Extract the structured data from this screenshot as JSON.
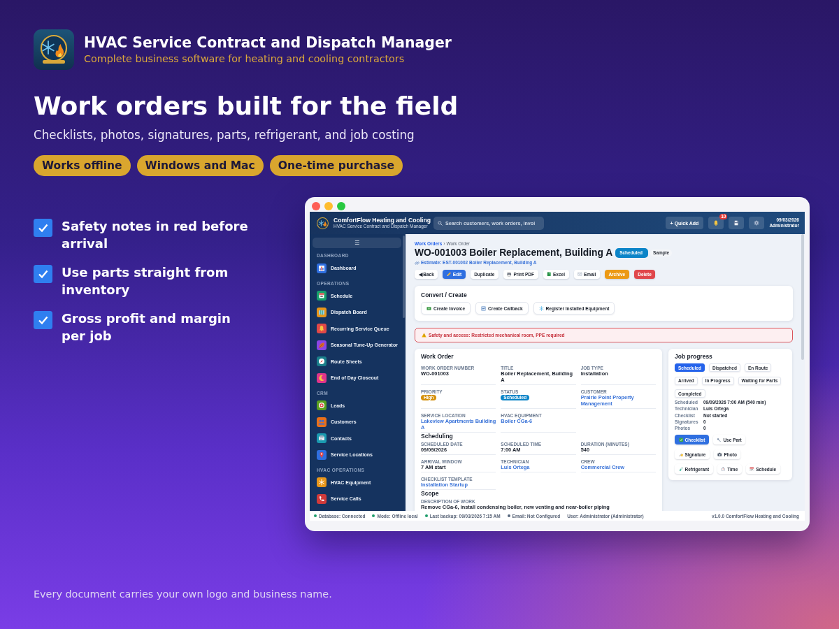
{
  "header": {
    "title": "HVAC Service Contract and Dispatch Manager",
    "subtitle": "Complete business software for heating and cooling contractors"
  },
  "headline": "Work orders built for the field",
  "subheadline": "Checklists, photos, signatures, parts, refrigerant, and job costing",
  "pills": [
    "Works offline",
    "Windows and Mac",
    "One-time purchase"
  ],
  "features": [
    "Safety notes in red before arrival",
    "Use parts straight from inventory",
    "Gross profit and margin per job"
  ],
  "app": {
    "topbar": {
      "title": "ComfortFlow Heating and Cooling",
      "subtitle": "HVAC Service Contract and Dispatch Manager",
      "search": {
        "placeholder": "Search customers, work orders, invoi"
      },
      "quick_add": "+ Quick Add",
      "notification_count": "10",
      "date": "09/03/2026",
      "user": "Administrator"
    },
    "sidebar": {
      "toggle": "☰",
      "sections": [
        {
          "label": "DASHBOARD",
          "items": [
            {
              "label": "Dashboard",
              "selected": false
            }
          ]
        },
        {
          "label": "OPERATIONS",
          "items": [
            {
              "label": "Schedule",
              "selected": false
            },
            {
              "label": "Dispatch Board",
              "selected": false
            },
            {
              "label": "Recurring Service Queue",
              "selected": false
            },
            {
              "label": "Seasonal Tune-Up Generator",
              "selected": false
            },
            {
              "label": "Route Sheets",
              "selected": false
            },
            {
              "label": "End of Day Closeout",
              "selected": false
            }
          ]
        },
        {
          "label": "CRM",
          "items": [
            {
              "label": "Leads",
              "selected": false
            },
            {
              "label": "Customers",
              "selected": false
            },
            {
              "label": "Contacts",
              "selected": false
            },
            {
              "label": "Service Locations",
              "selected": false
            }
          ]
        },
        {
          "label": "HVAC OPERATIONS",
          "items": [
            {
              "label": "HVAC Equipment",
              "selected": false
            },
            {
              "label": "Service Calls",
              "selected": false
            }
          ]
        }
      ]
    },
    "breadcrumb": {
      "link": "Work Orders",
      "separator": "›",
      "current": "Work Order"
    },
    "title": "WO-001003 Boiler Replacement, Building A",
    "badges": [
      {
        "label": "Scheduled",
        "kind": "status"
      },
      {
        "label": "Sample",
        "kind": "tag"
      }
    ],
    "estimate_link": "Estimate: EST-001002 Boiler Replacement, Building A",
    "actions": [
      {
        "label": "◀ Back",
        "kind": "plain"
      },
      {
        "label": "Edit",
        "kind": "primary"
      },
      {
        "label": "Duplicate",
        "kind": "plain"
      },
      {
        "label": "Print PDF",
        "kind": "plain"
      },
      {
        "label": "Excel",
        "kind": "plain"
      },
      {
        "label": "Email",
        "kind": "plain"
      },
      {
        "label": "Archive",
        "kind": "warning"
      },
      {
        "label": "Delete",
        "kind": "danger"
      }
    ],
    "convert": {
      "title": "Convert / Create",
      "buttons": [
        "Create Invoice",
        "Create Callback",
        "Register Installed Equipment"
      ]
    },
    "alert": "Safety and access: Restricted mechanical room, PPE required",
    "work_order": {
      "title": "Work Order",
      "sections": [
        {
          "fields": [
            {
              "label": "WORK ORDER NUMBER",
              "value": "WO-001003",
              "kind": "text"
            },
            {
              "label": "TITLE",
              "value": "Boiler Replacement, Building A",
              "kind": "text"
            },
            {
              "label": "JOB TYPE",
              "value": "Installation",
              "kind": "text"
            },
            {
              "label": "PRIORITY",
              "value": "High",
              "kind": "badge",
              "color": "#d4900c"
            },
            {
              "label": "STATUS",
              "value": "Scheduled",
              "kind": "badge",
              "color": "#0b84c8"
            },
            {
              "label": "CUSTOMER",
              "value": "Prairie Point Property Management",
              "kind": "link"
            },
            {
              "label": "SERVICE LOCATION",
              "value": "Lakeview Apartments Building A",
              "kind": "link"
            },
            {
              "label": "HVAC EQUIPMENT",
              "value": "Boiler CGa-6",
              "kind": "link"
            }
          ]
        },
        {
          "heading": "Scheduling",
          "fields": [
            {
              "label": "SCHEDULED DATE",
              "value": "09/09/2026",
              "kind": "text"
            },
            {
              "label": "SCHEDULED TIME",
              "value": "7:00 AM",
              "kind": "text"
            },
            {
              "label": "DURATION (MINUTES)",
              "value": "540",
              "kind": "text"
            },
            {
              "label": "ARRIVAL WINDOW",
              "value": "7 AM start",
              "kind": "text"
            },
            {
              "label": "TECHNICIAN",
              "value": "Luis Ortega",
              "kind": "link"
            },
            {
              "label": "CREW",
              "value": "Commercial Crew",
              "kind": "link"
            },
            {
              "label": "CHECKLIST TEMPLATE",
              "value": "Installation Startup",
              "kind": "link"
            }
          ]
        },
        {
          "heading": "Scope",
          "fields": [
            {
              "label": "DESCRIPTION OF WORK",
              "value": "Remove CGa-6, install condensing boiler, new venting and near-boiler piping",
              "kind": "paragraph"
            }
          ]
        }
      ]
    },
    "job_progress": {
      "title": "Job progress",
      "statuses": [
        {
          "label": "Scheduled",
          "selected": true
        },
        {
          "label": "Dispatched",
          "selected": false
        },
        {
          "label": "En Route",
          "selected": false
        },
        {
          "label": "Arrived",
          "selected": false
        },
        {
          "label": "In Progress",
          "selected": false
        },
        {
          "label": "Waiting for Parts",
          "selected": false
        },
        {
          "label": "Completed",
          "selected": false
        }
      ],
      "details": [
        {
          "label": "Scheduled",
          "value": "09/09/2026 7:00 AM (540 min)"
        },
        {
          "label": "Technician",
          "value": "Luis Ortega"
        },
        {
          "label": "Checklist",
          "value": "Not started"
        },
        {
          "label": "Signatures",
          "value": "0"
        },
        {
          "label": "Photos",
          "value": "0"
        }
      ],
      "actions": [
        {
          "label": "Checklist",
          "kind": "primary"
        },
        {
          "label": "Use Part",
          "kind": "plain"
        },
        {
          "label": "Signature",
          "kind": "plain"
        },
        {
          "label": "Photo",
          "kind": "plain"
        },
        {
          "label": "Refrigerant",
          "kind": "plain"
        },
        {
          "label": "Time",
          "kind": "plain"
        },
        {
          "label": "Schedule",
          "kind": "plain"
        }
      ]
    },
    "status_bar": {
      "items": [
        {
          "text": "Database: Connected",
          "color": "#1f9d6b"
        },
        {
          "text": "Mode: Offline local",
          "color": "#1f9d6b"
        },
        {
          "text": "Last backup: 09/03/2026 7:15 AM",
          "color": "#1f9d6b"
        },
        {
          "text": "Email: Not Configured",
          "color": "#56667c"
        },
        {
          "text": "User: Administrator (Administrator)"
        }
      ],
      "version": "v1.0.0 ComfortFlow Heating and Cooling"
    }
  },
  "footer": "Every document carries your own logo and business name."
}
